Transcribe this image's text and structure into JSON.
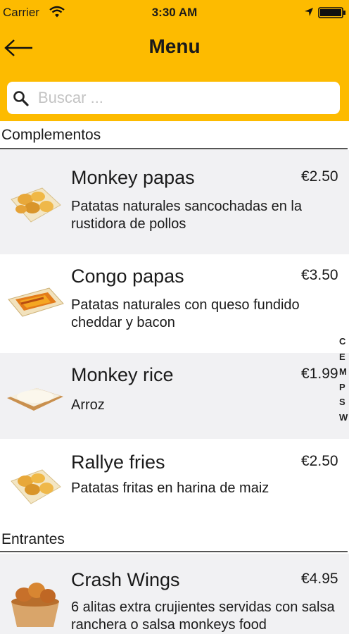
{
  "status_bar": {
    "carrier": "Carrier",
    "time": "3:30 AM"
  },
  "nav": {
    "title": "Menu"
  },
  "search": {
    "placeholder": "Buscar ..."
  },
  "sections": [
    {
      "title": "Complementos",
      "items": [
        {
          "name": "Monkey papas",
          "price": "€2.50",
          "desc": "Patatas naturales sancochadas en la rustidora de pollos",
          "icon": "potatoes-tray-image"
        },
        {
          "name": "Congo papas",
          "price": "€3.50",
          "desc": "Patatas naturales con queso fundido cheddar y bacon",
          "icon": "cheese-fries-image"
        },
        {
          "name": "Monkey rice",
          "price": "€1.99",
          "desc": "Arroz",
          "icon": "rice-tray-image"
        },
        {
          "name": "Rallye fries",
          "price": "€2.50",
          "desc": "Patatas fritas en harina de maiz",
          "icon": "fries-tray-image"
        }
      ]
    },
    {
      "title": "Entrantes",
      "items": [
        {
          "name": "Crash Wings",
          "price": "€4.95",
          "desc": "6 alitas extra crujientes servidas con salsa ranchera o salsa monkeys food",
          "icon": "chicken-wings-image"
        }
      ]
    }
  ],
  "index_bar": [
    "C",
    "E",
    "M",
    "P",
    "S",
    "W"
  ],
  "colors": {
    "header_bg": "#fdbb00",
    "row_alt_bg": "#f1f1f3",
    "row_bg": "#ffffff"
  }
}
